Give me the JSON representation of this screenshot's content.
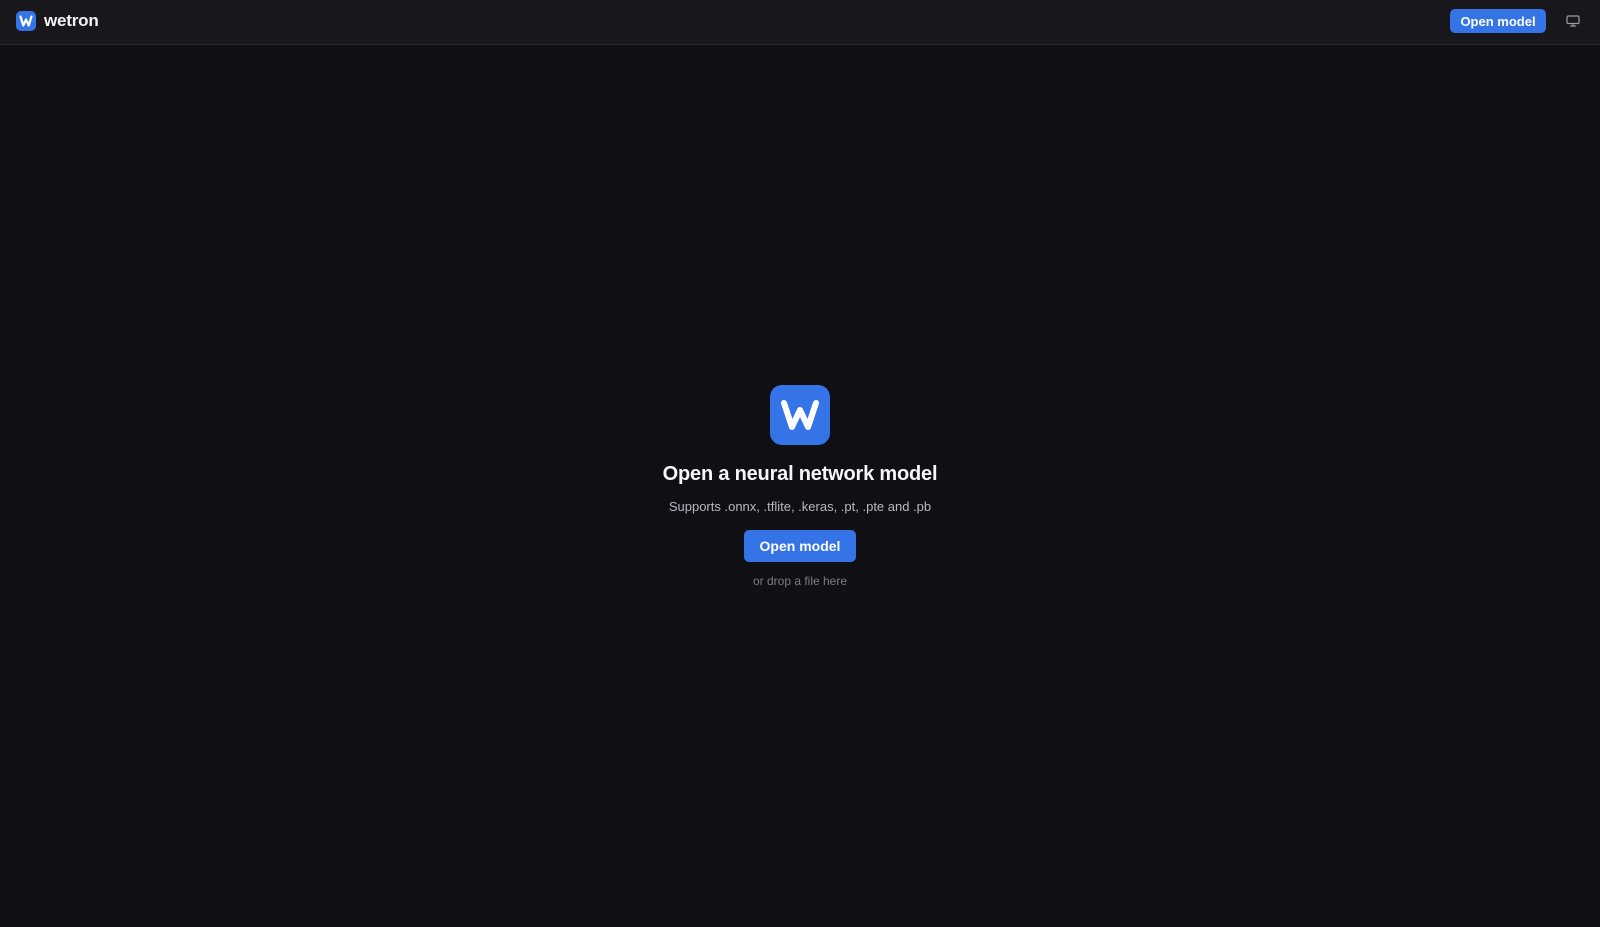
{
  "app": {
    "name": "wetron"
  },
  "header": {
    "open_button_label": "Open model",
    "theme_icon": "monitor-icon"
  },
  "hero": {
    "logo_letter": "W",
    "title": "Open a neural network model",
    "subtitle": "Supports .onnx, .tflite, .keras, .pt, .pte and .pb",
    "open_button_label": "Open model",
    "drop_hint": "or drop a file here"
  },
  "colors": {
    "accent": "#3574e6",
    "background": "#101014",
    "header_background": "#17171c"
  }
}
